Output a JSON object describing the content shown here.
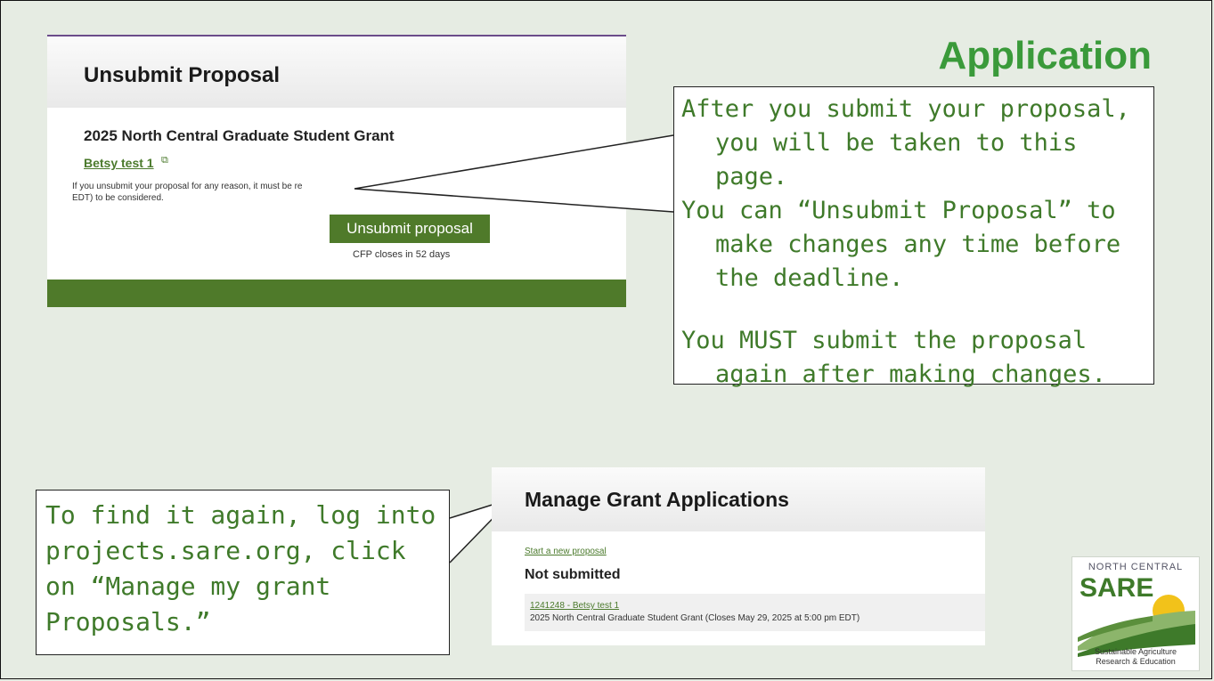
{
  "slide": {
    "title": "Application"
  },
  "unsubmit_screen": {
    "header": "Unsubmit Proposal",
    "grant_name": "2025 North Central Graduate Student Grant",
    "proposal_title": "Betsy test 1",
    "note": "If you unsubmit your proposal for any reason, it must be re\nEDT) to be considered.",
    "button_label": "Unsubmit proposal",
    "closes_text": "CFP closes in 52 days"
  },
  "callout_right": {
    "lines": [
      "After you submit your proposal, you will be taken to this page.",
      "You can “Unsubmit Proposal” to make changes any time before the deadline.",
      "You MUST submit the proposal again after making changes."
    ]
  },
  "callout_left": {
    "lines": [
      "To find it again, log into",
      "projects.sare.org, click",
      "on  “Manage my grant",
      "Proposals.”"
    ]
  },
  "manage_screen": {
    "header": "Manage Grant Applications",
    "new_link": "Start a new proposal",
    "section": "Not submitted",
    "row_link": "1241248 - Betsy test 1",
    "row_desc": "2025 North Central Graduate Student Grant (Closes May 29, 2025 at 5:00 pm EDT)"
  },
  "logo": {
    "top_text": "NORTH CENTRAL",
    "brand": "SARE",
    "subtitle": "Sustainable Agriculture\nResearch & Education"
  },
  "colors": {
    "accent_green": "#4f7a2a",
    "title_green": "#3a9a3a",
    "callout_text": "#3f7a2a"
  }
}
